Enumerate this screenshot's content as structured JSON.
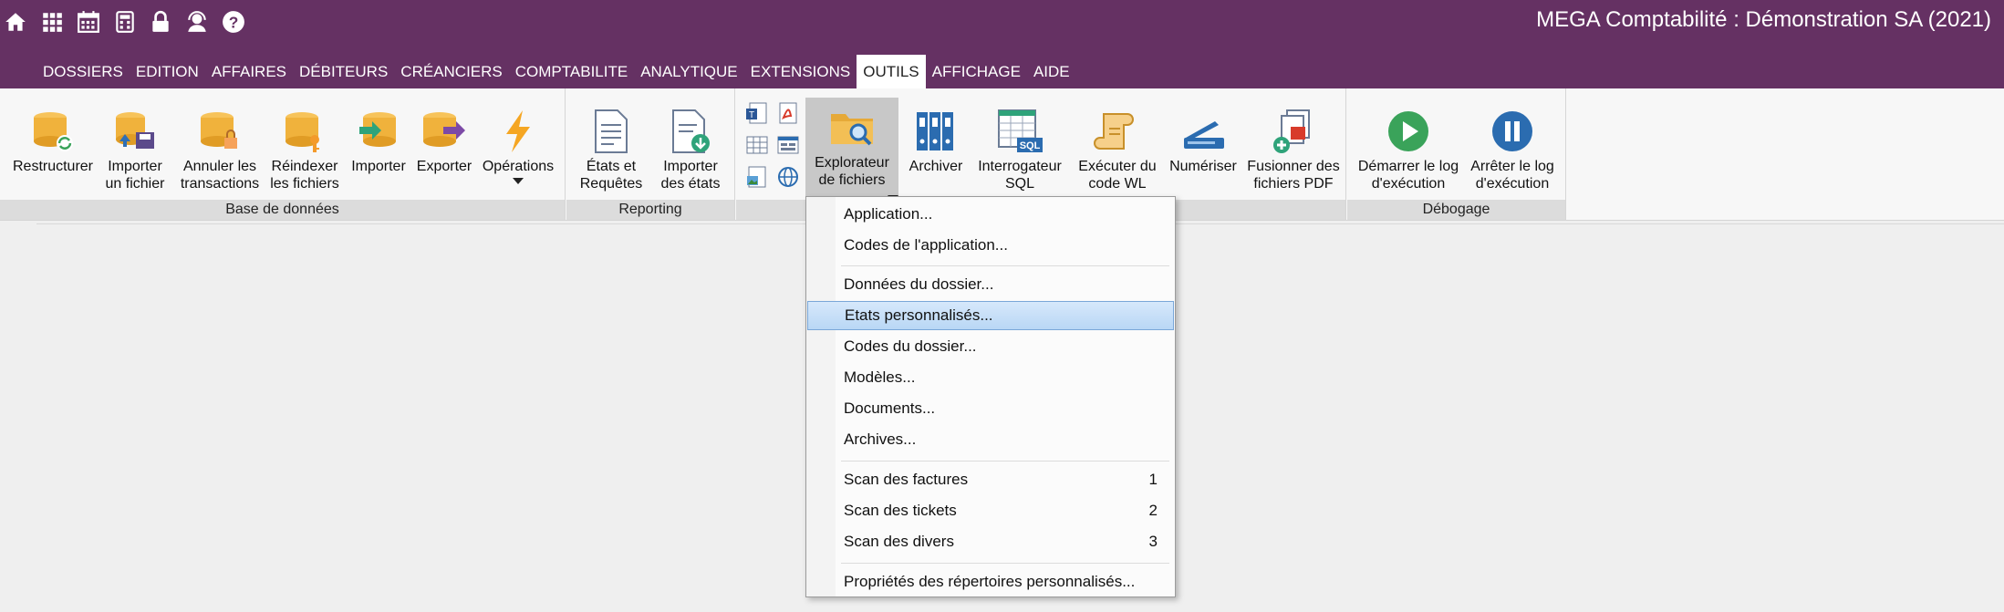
{
  "app": {
    "title": "MEGA Comptabilité : Démonstration SA (2021)"
  },
  "toolbar_icons": [
    "home-icon",
    "grid-icon",
    "calendar-icon",
    "calculator-icon",
    "lock-icon",
    "support-icon",
    "help-icon"
  ],
  "menu": [
    "DOSSIERS",
    "EDITION",
    "AFFAIRES",
    "DÉBITEURS",
    "CRÉANCIERS",
    "COMPTABILITE",
    "ANALYTIQUE",
    "EXTENSIONS",
    "OUTILS",
    "AFFICHAGE",
    "AIDE"
  ],
  "active_menu": "OUTILS",
  "ribbon": {
    "database": {
      "label": "Base de données",
      "buttons": [
        "Restructurer",
        "Importer\nun fichier",
        "Annuler les\ntransactions",
        "Réindexer\nles fichiers",
        "Importer",
        "Exporter",
        "Opérations"
      ]
    },
    "reporting": {
      "label": "Reporting",
      "buttons": [
        "États et\nRequêtes",
        "Importer\ndes états"
      ]
    },
    "tools": {
      "label": "",
      "buttons": [
        "Explorateur\nde fichiers",
        "Archiver",
        "Interrogateur\nSQL",
        "Exécuter du\ncode WL",
        "Numériser",
        "Fusionner des\nfichiers PDF"
      ]
    },
    "debug": {
      "label": "Débogage",
      "buttons": [
        "Démarrer le log\nd'exécution",
        "Arrêter le log\nd'exécution"
      ]
    }
  },
  "dropdown": {
    "items": [
      {
        "label": "Application...",
        "shortcut": ""
      },
      {
        "label": "Codes de l'application...",
        "shortcut": ""
      },
      {
        "label": "Données du dossier...",
        "shortcut": ""
      },
      {
        "label": "Etats personnalisés...",
        "shortcut": "",
        "highlighted": true
      },
      {
        "label": "Codes du dossier...",
        "shortcut": ""
      },
      {
        "label": "Modèles...",
        "shortcut": ""
      },
      {
        "label": "Documents...",
        "shortcut": ""
      },
      {
        "label": "Archives...",
        "shortcut": ""
      },
      {
        "label": "Scan des factures",
        "shortcut": "1"
      },
      {
        "label": "Scan des tickets",
        "shortcut": "2"
      },
      {
        "label": "Scan des divers",
        "shortcut": "3"
      },
      {
        "label": "Propriétés des répertoires personnalisés...",
        "shortcut": ""
      }
    ]
  },
  "colors": {
    "titlebar": "#653163",
    "ribbon": "#f7f7f7",
    "highlight": "#c7dff7"
  }
}
